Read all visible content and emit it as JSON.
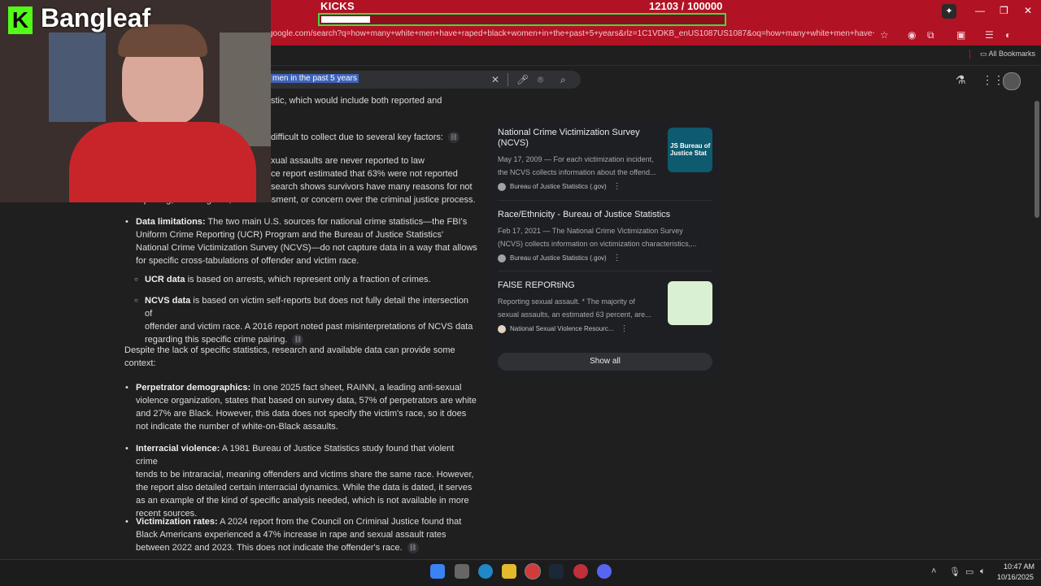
{
  "kicks": {
    "title": "KICKS",
    "count": "12103  / 100000",
    "progress_fraction": 0.121
  },
  "browser": {
    "url": "google.com/search?q=how+many+white+men+have+raped+black+women+in+the+past+5+years&rlz=1C1VDKB_enUS1087US1087&oq=how+many+white+men+have+raped+black+women+in+the+past+5+years&gs_lcrp=EgZja...",
    "all_bookmarks": "All Bookmarks"
  },
  "search": {
    "query_visible": "men in the past 5 years"
  },
  "overlay": {
    "logo_letter": "K",
    "logo_text": "Bangleaf"
  },
  "article": {
    "p0": "stic, which would include both reported and",
    "p1": "difficult to collect due to several key factors:",
    "p2a": "xual assaults are never reported to law",
    "p2b": "ce report estimated that 63% were not reported",
    "p2c": "search shows survivors have many reasons for not",
    "p2d": "reporting, including fear, embarrassment, or concern over the criminal justice process.",
    "dl_label": "Data limitations:",
    "dl_text1": " The two main U.S. sources for national crime statistics—the FBI's",
    "dl_text2": "Uniform Crime Reporting (UCR) Program and the Bureau of Justice Statistics'",
    "dl_text3": "National Crime Victimization Survey (NCVS)—do not capture data in a way that allows",
    "dl_text4": "for specific cross-tabulations of offender and victim race.",
    "ucr_label": "UCR data",
    "ucr_text": " is based on arrests, which represent only a fraction of crimes.",
    "ncvs_label": "NCVS data",
    "ncvs_text1": " is based on victim self-reports but does not fully detail the intersection of",
    "ncvs_text2": "offender and victim race. A 2016 report noted past misinterpretations of NCVS data",
    "ncvs_text3": "regarding this specific crime pairing.",
    "despite1": "Despite the lack of specific statistics, research and available data can provide some",
    "despite2": "context:",
    "perp_label": "Perpetrator demographics:",
    "perp_text1": " In one 2025 fact sheet, RAINN, a leading anti-sexual",
    "perp_text2": "violence organization, states that based on survey data, 57% of perpetrators are white",
    "perp_text3": "and 27% are Black. However, this data does not specify the victim's race, so it does",
    "perp_text4": "not indicate the number of white-on-Black assaults.",
    "inter_label": "Interracial violence:",
    "inter_text1": " A 1981 Bureau of Justice Statistics study found that violent crime",
    "inter_text2": "tends to be intraracial, meaning offenders and victims share the same race. However,",
    "inter_text3": "the report also detailed certain interracial dynamics. While the data is dated, it serves",
    "inter_text4": "as an example of the kind of specific analysis needed, which is not available in more",
    "inter_text5": "recent sources.",
    "vict_label": "Victimization rates:",
    "vict_text1": " A 2024 report from the Council on Criminal Justice found that",
    "vict_text2": "Black Americans experienced a 47% increase in rape and sexual assault rates",
    "vict_text3": "between 2022 and 2023. This does not indicate the offender's race."
  },
  "sources": [
    {
      "title": "National Crime Victimization Survey (NCVS)",
      "snippet1": "May 17, 2009 — For each victimization incident,",
      "snippet2": "the NCVS collects information about the offend...",
      "site": "Bureau of Justice Statistics (.gov)",
      "thumb_text": "JS Bureau of Justice Stat"
    },
    {
      "title": "Race/Ethnicity - Bureau of Justice Statistics",
      "snippet1": "Feb 17, 2021 — The National Crime Victimization Survey",
      "snippet2": "(NCVS) collects information on victimization characteristics,...",
      "site": "Bureau of Justice Statistics (.gov)"
    },
    {
      "title": "FAlSE REPORtiNG",
      "snippet1": "Reporting sexual assault. * The majority of",
      "snippet2": "sexual assaults, an estimated 63 percent, are...",
      "site": "National Sexual Violence Resourc..."
    }
  ],
  "show_all": "Show all",
  "taskbar": {
    "time": "10:47 AM",
    "date": "10/16/2025"
  },
  "colors": {
    "kick_green": "#53fc18",
    "stream_red": "#b11224",
    "progress_border": "#3fdc3f"
  }
}
